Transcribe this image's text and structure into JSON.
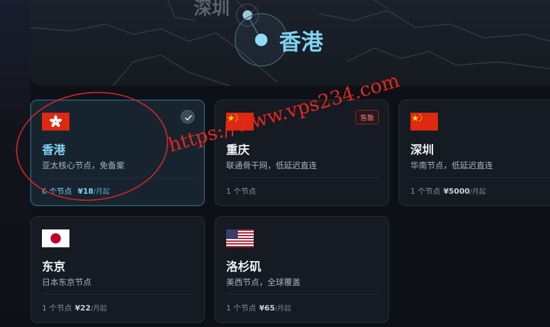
{
  "map": {
    "labels": {
      "shenzhen": "深圳",
      "hongkong": "香港"
    }
  },
  "regions": [
    {
      "city": "香港",
      "desc": "亚太核心节点，免备案",
      "nodes": "6 个节点",
      "price": "¥18",
      "per": "/月起",
      "selected": true
    },
    {
      "city": "重庆",
      "desc": "联通骨干网，低延迟直连",
      "nodes": "1 个节点",
      "price": "",
      "per": "",
      "badge": "售罄"
    },
    {
      "city": "深圳",
      "desc": "华南节点，低延迟直连",
      "nodes": "1 个节点",
      "price": "¥5000",
      "per": "/月起"
    },
    {
      "city": "东京",
      "desc": "日本东京节点",
      "nodes": "1 个节点",
      "price": "¥22",
      "per": "/月起"
    },
    {
      "city": "洛杉矶",
      "desc": "美西节点，全球覆盖",
      "nodes": "1 个节点",
      "price": "¥65",
      "per": "/月起"
    }
  ],
  "watermark": "https://www.vps234.com",
  "colors": {
    "accent": "#7fd3f0",
    "soldout": "#e07a7e",
    "annotation": "#e0281f"
  }
}
